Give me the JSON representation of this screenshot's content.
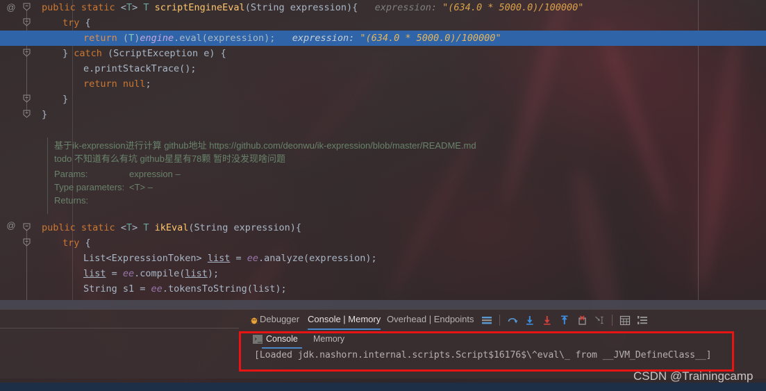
{
  "editor": {
    "lines": [
      {
        "indent": 0,
        "tokens": [
          {
            "t": "public ",
            "c": "kw"
          },
          {
            "t": "static ",
            "c": "kw"
          },
          {
            "t": "<",
            "c": "plain"
          },
          {
            "t": "T",
            "c": "typ"
          },
          {
            "t": "> ",
            "c": "plain"
          },
          {
            "t": "T",
            "c": "typ"
          },
          {
            "t": " ",
            "c": "plain"
          },
          {
            "t": "scriptEngineEval",
            "c": "fn"
          },
          {
            "t": "(String expression){",
            "c": "plain"
          }
        ],
        "hint": "expression:",
        "hint_value": "\"(634.0 * 5000.0)/100000\"",
        "highlight": false
      },
      {
        "indent": 1,
        "tokens": [
          {
            "t": "try",
            "c": "kw"
          },
          {
            "t": " {",
            "c": "plain"
          }
        ],
        "highlight": false
      },
      {
        "indent": 2,
        "tokens": [
          {
            "t": "return",
            "c": "kw"
          },
          {
            "t": " (",
            "c": "plain"
          },
          {
            "t": "T",
            "c": "typ"
          },
          {
            "t": ")",
            "c": "plain"
          },
          {
            "t": "engine",
            "c": "fld"
          },
          {
            "t": ".eval(expression);",
            "c": "plain"
          }
        ],
        "hint": "expression:",
        "hint_value": "\"(634.0 * 5000.0)/100000\"",
        "highlight": true
      },
      {
        "indent": 1,
        "tokens": [
          {
            "t": "} ",
            "c": "plain"
          },
          {
            "t": "catch",
            "c": "kw"
          },
          {
            "t": " (ScriptException e) {",
            "c": "plain"
          }
        ],
        "highlight": false
      },
      {
        "indent": 2,
        "tokens": [
          {
            "t": "e.printStackTrace();",
            "c": "plain"
          }
        ],
        "highlight": false
      },
      {
        "indent": 2,
        "tokens": [
          {
            "t": "return",
            "c": "kw"
          },
          {
            "t": " ",
            "c": "plain"
          },
          {
            "t": "null",
            "c": "kw"
          },
          {
            "t": ";",
            "c": "plain"
          }
        ],
        "highlight": false
      },
      {
        "indent": 1,
        "tokens": [
          {
            "t": "}",
            "c": "plain"
          }
        ],
        "highlight": false
      },
      {
        "indent": 0,
        "tokens": [
          {
            "t": "}",
            "c": "plain"
          }
        ],
        "highlight": false
      }
    ],
    "lines2": [
      {
        "indent": 0,
        "tokens": [
          {
            "t": "public ",
            "c": "kw"
          },
          {
            "t": "static ",
            "c": "kw"
          },
          {
            "t": "<",
            "c": "plain"
          },
          {
            "t": "T",
            "c": "typ"
          },
          {
            "t": "> ",
            "c": "plain"
          },
          {
            "t": "T",
            "c": "typ"
          },
          {
            "t": " ",
            "c": "plain"
          },
          {
            "t": "ikEval",
            "c": "fn"
          },
          {
            "t": "(String expression){",
            "c": "plain"
          }
        ]
      },
      {
        "indent": 1,
        "tokens": [
          {
            "t": "try",
            "c": "kw"
          },
          {
            "t": " {",
            "c": "plain"
          }
        ]
      },
      {
        "indent": 2,
        "tokens": [
          {
            "t": "List<ExpressionToken> ",
            "c": "plain"
          },
          {
            "t": "list",
            "c": "locv"
          },
          {
            "t": " = ",
            "c": "plain"
          },
          {
            "t": "ee",
            "c": "fld"
          },
          {
            "t": ".analyze(expression);",
            "c": "plain"
          }
        ]
      },
      {
        "indent": 2,
        "tokens": [
          {
            "t": "list",
            "c": "locv"
          },
          {
            "t": " = ",
            "c": "plain"
          },
          {
            "t": "ee",
            "c": "fld"
          },
          {
            "t": ".compile(",
            "c": "plain"
          },
          {
            "t": "list",
            "c": "locv"
          },
          {
            "t": ");",
            "c": "plain"
          }
        ]
      },
      {
        "indent": 2,
        "tokens": [
          {
            "t": "String s1 = ",
            "c": "plain"
          },
          {
            "t": "ee",
            "c": "fld"
          },
          {
            "t": ".tokensToString(list);",
            "c": "plain"
          }
        ]
      }
    ],
    "javadoc": {
      "description": "基于ik-expression进行计算 github地址 https://github.com/deonwu/ik-expression/blob/master/README.md todo 不知道有么有坑 github星星有78颗 暂时没发现啥问题",
      "params_label": "Params:",
      "params_value": "expression –",
      "type_params_label": "Type parameters:",
      "type_params_value": "<T> –",
      "returns_label": "Returns:"
    },
    "gutter": {
      "annotation_marker": "@",
      "breakpoint_check": "✓"
    }
  },
  "bottom_panel": {
    "tabs": [
      {
        "label": "Debugger",
        "active": false,
        "icon": "bug-icon"
      },
      {
        "label": "Console | Memory",
        "active": true
      },
      {
        "label": "Overhead | Endpoints",
        "active": false
      }
    ],
    "toolbar_icons": [
      "layout-icon",
      "step-over-icon",
      "step-into-icon",
      "force-step-into-icon",
      "step-out-icon",
      "drop-frame-icon",
      "run-to-cursor-icon",
      "evaluate-expression-icon",
      "settings-list-icon"
    ],
    "subtabs": [
      {
        "label": "Console",
        "active": true
      },
      {
        "label": "Memory",
        "active": false
      }
    ],
    "console_output": "[Loaded jdk.nashorn.internal.scripts.Script$16176$\\^eval\\_ from __JVM_DefineClass__]",
    "console_prompt_icon": "›_"
  },
  "watermark": "CSDN @Trainingcamp",
  "colors": {
    "highlight_line": "#2f65a8",
    "annotation_box": "#e81313",
    "accent_tab": "#4a88c7",
    "breakpoint": "#db5860",
    "keyword": "#cc7832",
    "method": "#ffc66d",
    "field": "#9876aa",
    "javadoc": "#69836a",
    "status_strip": "#1d2f47"
  }
}
